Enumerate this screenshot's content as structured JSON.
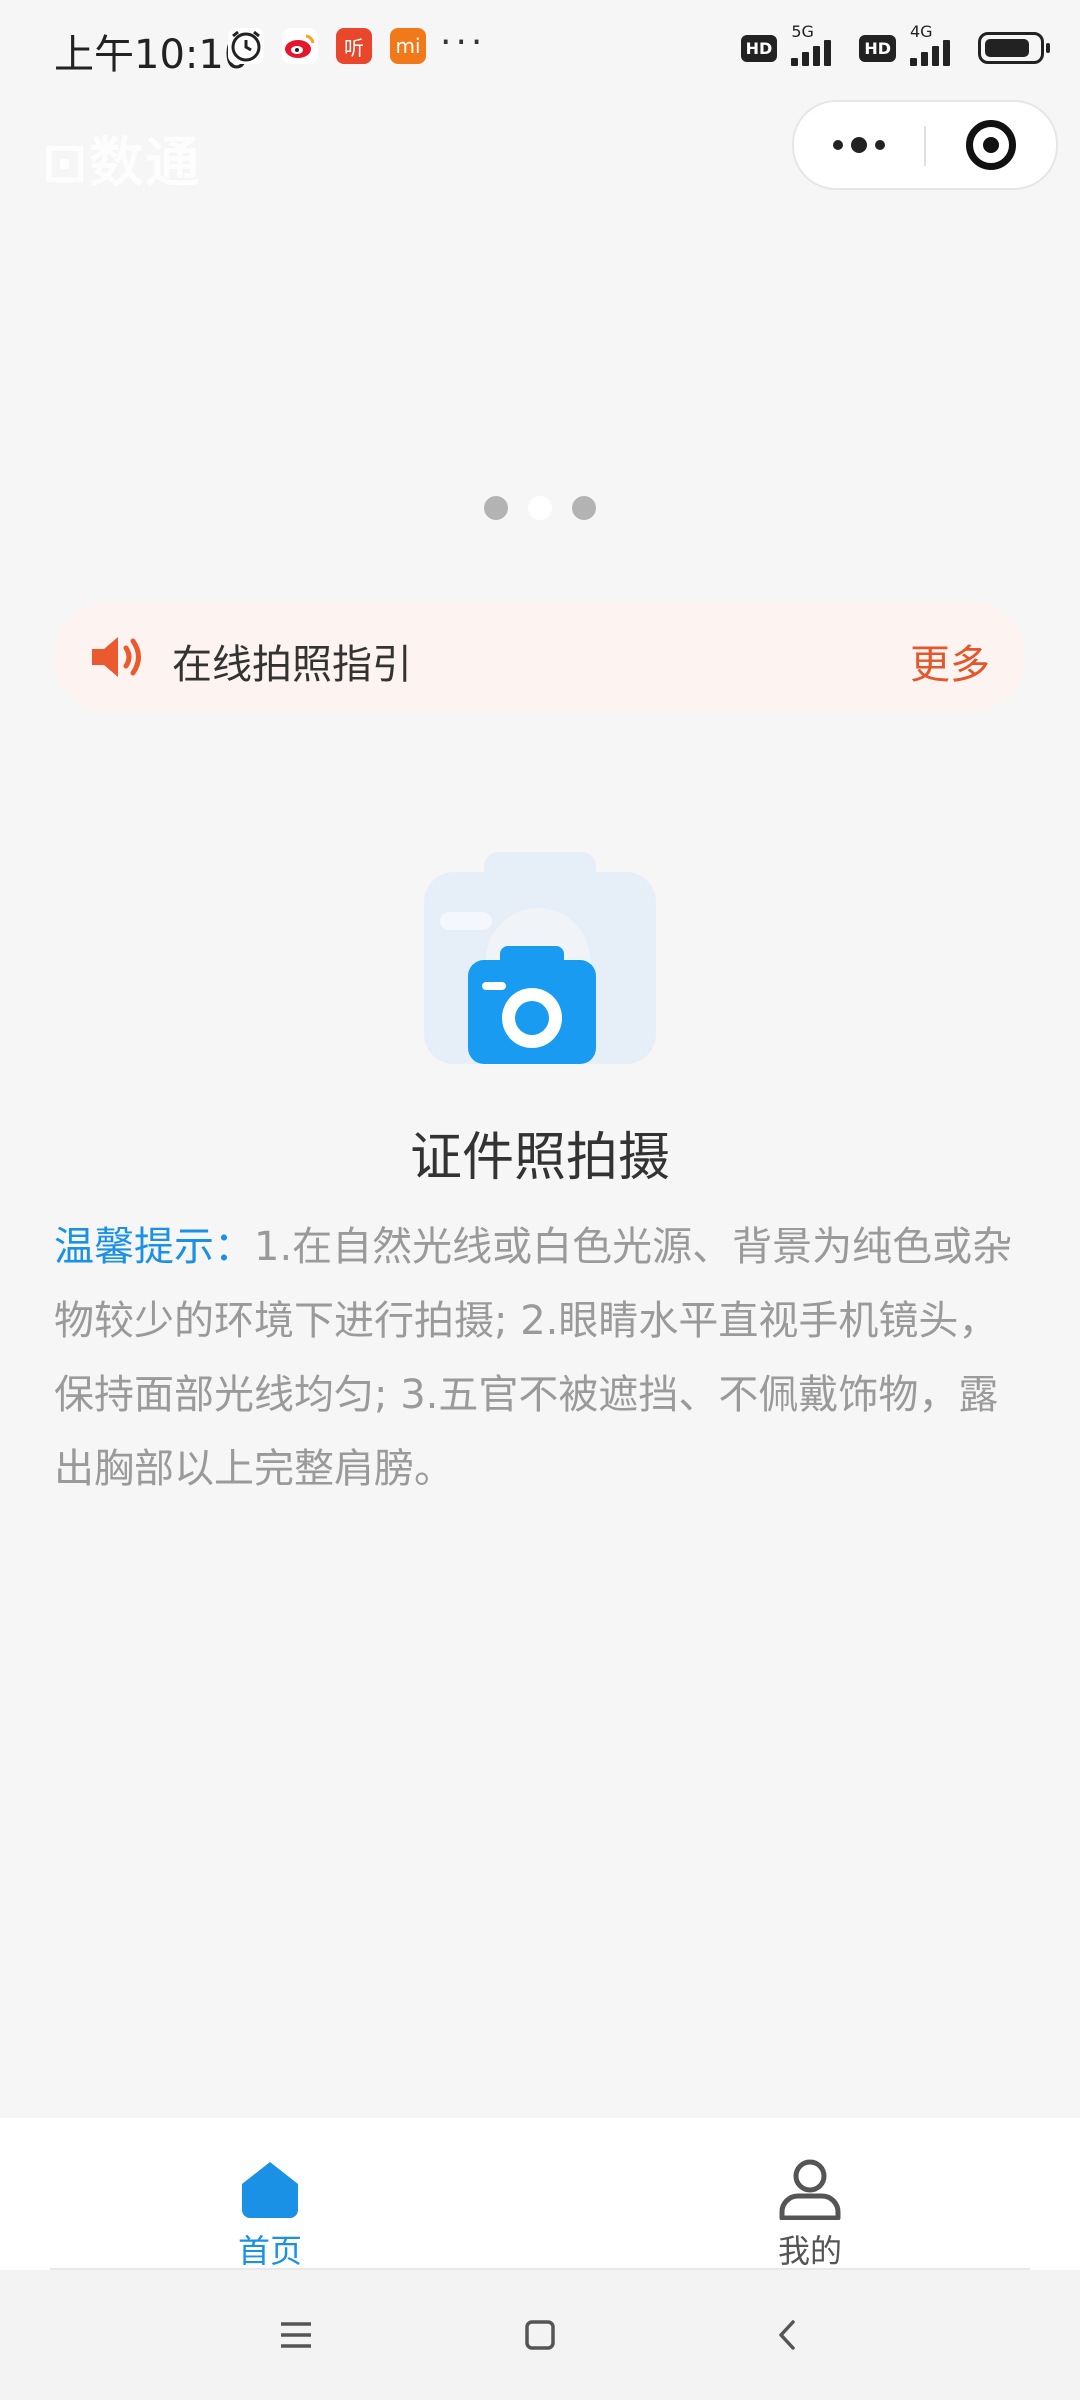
{
  "status_bar": {
    "time": "上午10:10",
    "network_labels": [
      "5G",
      "4G"
    ],
    "hd_label": "HD",
    "more_dots": "···"
  },
  "logo_text": "⊡数通",
  "carousel": {
    "dot_count": 3,
    "active_index": 1
  },
  "notice": {
    "text": "在线拍照指引",
    "more": "更多",
    "accent_color": "#e2572c"
  },
  "main": {
    "title": "证件照拍摄",
    "tip_label": "温馨提示：",
    "tip_text": "1.在自然光线或白色光源、背景为纯色或杂物较少的环境下进行拍摄; 2.眼睛水平直视手机镜头，保持面部光线均匀; 3.五官不被遮挡、不佩戴饰物，露出胸部以上完整肩膀。"
  },
  "tabbar": {
    "tabs": [
      {
        "label": "首页",
        "icon": "home-icon",
        "active": true
      },
      {
        "label": "我的",
        "icon": "person-icon",
        "active": false
      }
    ],
    "active_color": "#1b91e6"
  },
  "nav": {
    "buttons": [
      "menu-icon",
      "home-square-icon",
      "back-icon"
    ]
  }
}
